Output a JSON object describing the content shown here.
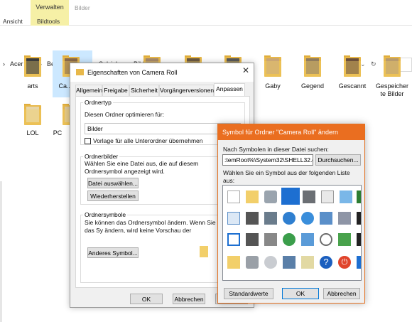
{
  "ribbon": {
    "context_tab": "Verwalten",
    "gray_tab": "Bilder",
    "left_label": "Ansicht",
    "group_label": "Bildtools"
  },
  "address": {
    "crumbs": [
      "Acer (C:)",
      "Benutzer",
      "Gaby Salvisberg",
      "Bilder"
    ]
  },
  "folders": [
    {
      "label": "arts"
    },
    {
      "label": "Ca..."
    },
    {
      "label": "Gaby"
    },
    {
      "label": "Gegend"
    },
    {
      "label": "Gescannt"
    },
    {
      "label": "Gespeicher\nte Bilder"
    },
    {
      "label": "LOL"
    },
    {
      "label": "PC"
    }
  ],
  "props_dialog": {
    "title": "Eigenschaften von Camera Roll",
    "tabs": [
      "Allgemein",
      "Freigabe",
      "Sicherheit",
      "Vorgängerversionen",
      "Anpassen"
    ],
    "group1_title": "Ordnertyp",
    "optimize_label": "Diesen Ordner optimieren für:",
    "optimize_value": "Bilder",
    "subfolder_check": "Vorlage für alle Unterordner übernehmen",
    "group2_title": "Ordnerbilder",
    "group2_text": "Wählen Sie eine Datei aus, die auf diesem Ordnersymbol angezeigt wird.",
    "choose_file": "Datei auswählen...",
    "restore": "Wiederherstellen",
    "group3_title": "Ordnersymbole",
    "group3_text": "Sie können das Ordnersymbol ändern. Wenn Sie das Sy ändern, wird keine Vorschau der Ordnerinhalte mehr an",
    "other_symbol": "Anderes Symbol...",
    "ok": "OK",
    "cancel": "Abbrechen"
  },
  "icon_dialog": {
    "title": "Symbol für Ordner \"Camera Roll\" ändern",
    "search_label": "Nach Symbolen in dieser Datei suchen:",
    "path": ":temRoot%\\System32\\SHELL32.dll",
    "browse": "Durchsuchen...",
    "list_label": "Wählen Sie ein Symbol aus der folgenden Liste aus:",
    "standard": "Standardwerte",
    "ok": "OK",
    "cancel": "Abbrechen"
  }
}
